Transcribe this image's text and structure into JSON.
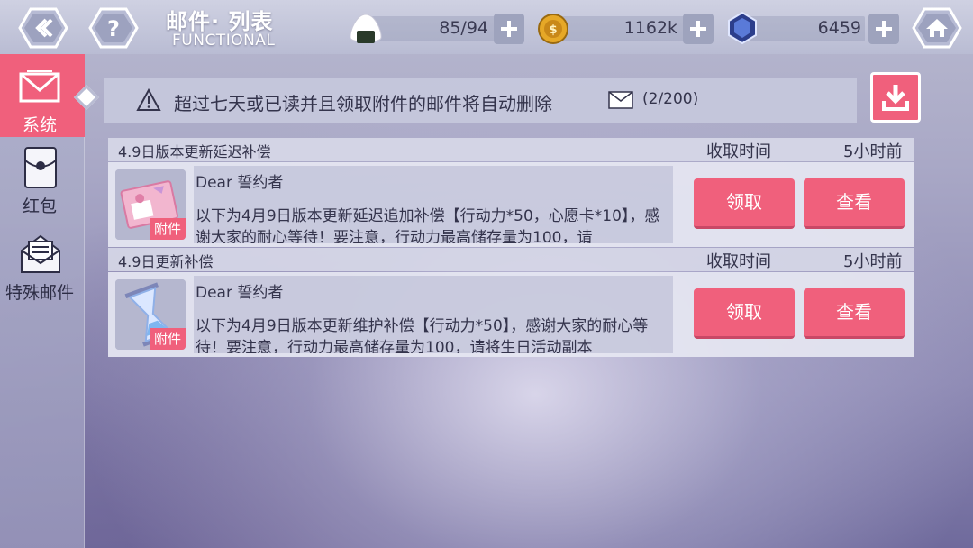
{
  "header": {
    "title": "邮件· 列表",
    "subtitle": "FUNCTIONAL",
    "stamina": "85/94",
    "coins": "1162k",
    "crystals": "6459"
  },
  "sidebar": {
    "items": [
      {
        "label": "系统",
        "icon": "mail-envelope-icon",
        "active": true
      },
      {
        "label": "红包",
        "icon": "red-envelope-icon",
        "active": false
      },
      {
        "label": "特殊邮件",
        "icon": "special-mail-icon",
        "active": false
      }
    ]
  },
  "notice": {
    "text": "超过七天或已读并且领取附件的邮件将自动删除",
    "count": "(2/200)"
  },
  "mails": [
    {
      "subject": "4.9日版本更新延迟补偿",
      "time_label": "收取时间",
      "time_value": "5小时前",
      "greeting": "Dear 誓约者",
      "content": "以下为4月9日版本更新延迟追加补偿【行动力*50，心愿卡*10】，感谢大家的耐心等待！要注意，行动力最高储存量为100，请",
      "attach_label": "附件",
      "claim_label": "领取",
      "view_label": "查看"
    },
    {
      "subject": "4.9日更新补偿",
      "time_label": "收取时间",
      "time_value": "5小时前",
      "greeting": "Dear 誓约者",
      "content": "以下为4月9日版本更新维护补偿【行动力*50】，感谢大家的耐心等待！要注意，行动力最高储存量为100，请将生日活动副本",
      "attach_label": "附件",
      "claim_label": "领取",
      "view_label": "查看"
    }
  ],
  "colors": {
    "accent": "#f0607c",
    "text": "#34344c"
  }
}
